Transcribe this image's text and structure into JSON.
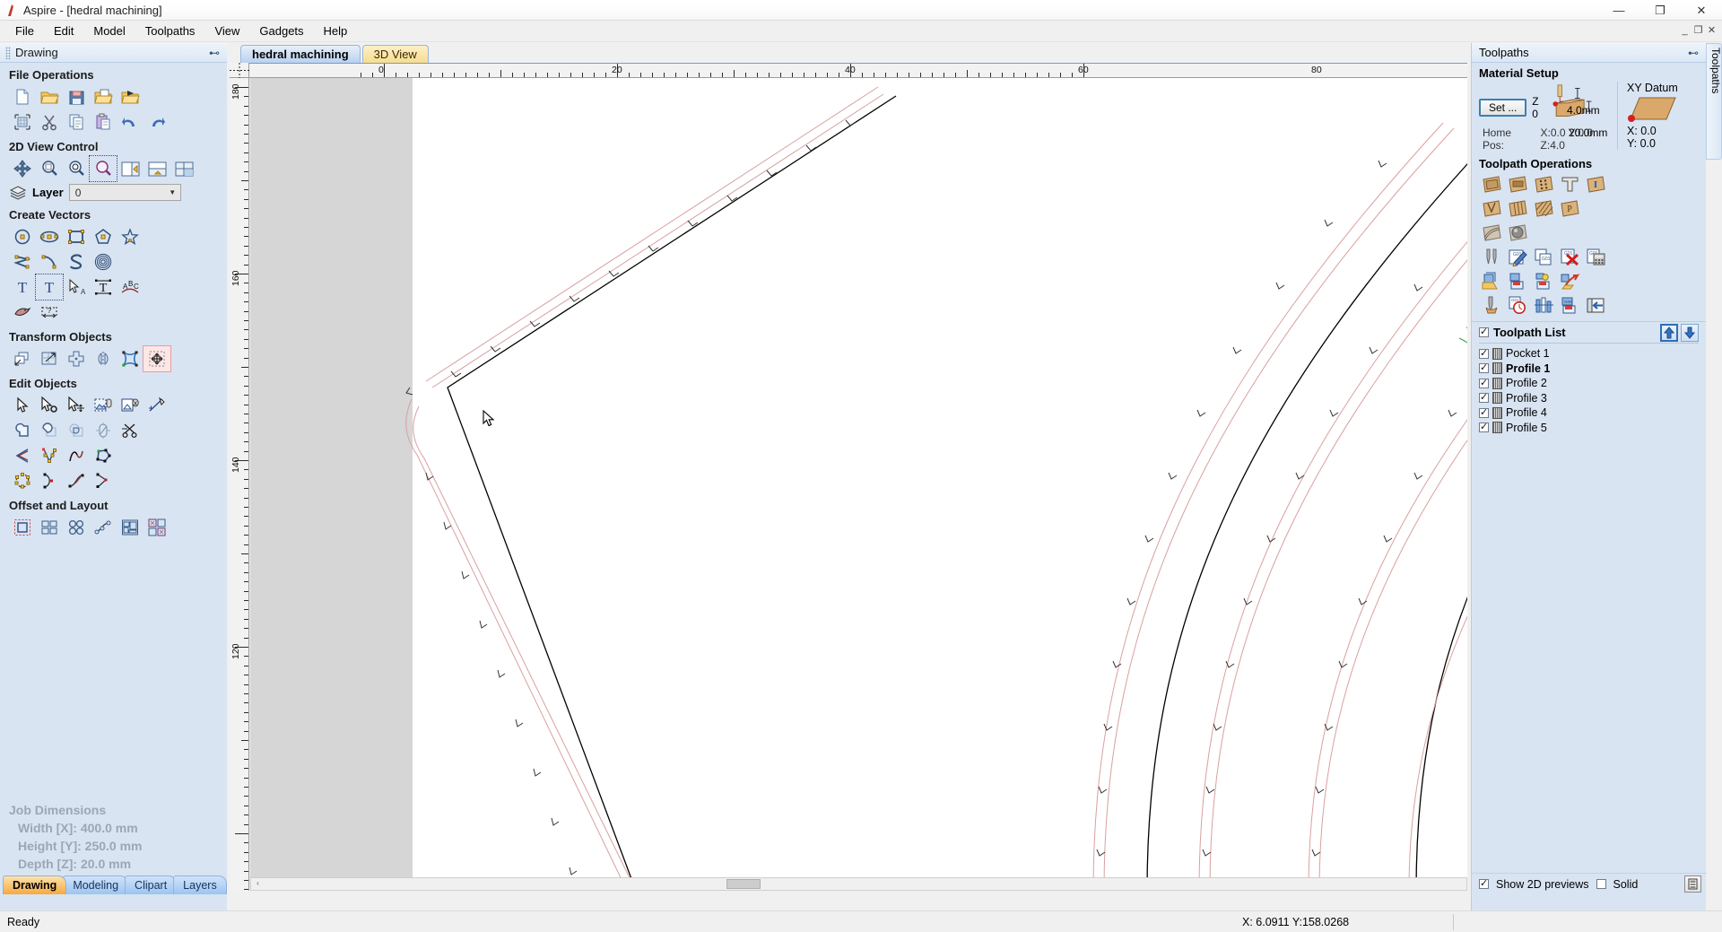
{
  "window": {
    "title": "Aspire - [hedral machining]",
    "app_icon": "aspire-logo-icon",
    "buttons": {
      "minimize": "—",
      "maximize": "❐",
      "close": "✕"
    },
    "mdi_buttons": {
      "minimize": "_",
      "restore": "❐",
      "close": "✕"
    }
  },
  "menubar": {
    "items": [
      {
        "label": "File"
      },
      {
        "label": "Edit"
      },
      {
        "label": "Model"
      },
      {
        "label": "Toolpaths"
      },
      {
        "label": "View"
      },
      {
        "label": "Gadgets"
      },
      {
        "label": "Help"
      }
    ]
  },
  "left_panel": {
    "caption": "Drawing",
    "pin_icon": "pin-icon",
    "sections": [
      {
        "title": "File Operations",
        "rows": [
          [
            "new-file-icon",
            "open-file-icon",
            "save-file-icon",
            "open-recent-icon",
            "import-vectors-icon"
          ],
          [
            "job-setup-icon",
            "cut-icon",
            "copy-icon",
            "paste-icon",
            "undo-icon",
            "redo-icon"
          ]
        ]
      },
      {
        "title": "2D View Control",
        "rows": [
          [
            "pan-view-icon",
            "zoom-window-icon",
            "zoom-selection-icon",
            "zoom-interactive-icon",
            "toggle-left-panel-icon",
            "toggle-split-view-icon",
            "toggle-layout-icon"
          ]
        ]
      },
      {
        "title": "Create Vectors",
        "rows": [
          [
            "circle-icon",
            "ellipse-icon",
            "rectangle-icon",
            "polygon-icon",
            "star-icon"
          ],
          [
            "polyline-icon",
            "arc-icon",
            "curve-icon",
            "spiral-icon"
          ],
          [
            "create-text-icon",
            "edit-text-icon",
            "text-select-icon",
            "text-on-curve-icon",
            "text-arc-icon"
          ],
          [
            "trace-bitmap-icon",
            "dimension-icon"
          ]
        ]
      },
      {
        "title": "Transform Objects",
        "rows": [
          [
            "move-object-icon",
            "scale-object-icon",
            "rotate-object-icon",
            "mirror-object-icon",
            "distort-object-icon",
            "align-objects-icon"
          ]
        ]
      },
      {
        "title": "Edit Objects",
        "rows": [
          [
            "select-tool-icon",
            "node-edit-icon",
            "move-nodes-icon",
            "group-vectors-icon",
            "ungroup-vectors-icon",
            "measure-icon"
          ],
          [
            "weld-vectors-icon",
            "subtract-vectors-icon",
            "intersect-vectors-icon",
            "fillet-icon",
            "trim-vectors-icon"
          ],
          [
            "join-open-vectors-icon",
            "node-tools-icon",
            "curve-fit-icon",
            "close-vector-icon"
          ],
          [
            "create-boundary-icon",
            "offset-corner-icon",
            "smooth-curve-icon",
            "split-vector-icon"
          ]
        ]
      },
      {
        "title": "Offset and Layout",
        "rows": [
          [
            "offset-vectors-icon",
            "array-copy-icon",
            "block-copy-icon",
            "copy-along-curve-icon",
            "nesting-icon",
            "plate-layout-icon"
          ]
        ]
      }
    ],
    "layer": {
      "label": "Layer",
      "icon": "layers-icon",
      "value": "0"
    },
    "job_dimensions": {
      "title": "Job Dimensions",
      "rows": [
        "Width  [X]: 400.0 mm",
        "Height [Y]: 250.0 mm",
        "Depth  [Z]: 20.0 mm"
      ]
    },
    "tabs": [
      {
        "label": "Drawing",
        "active": true
      },
      {
        "label": "Modeling",
        "active": false
      },
      {
        "label": "Clipart",
        "active": false
      },
      {
        "label": "Layers",
        "active": false
      }
    ]
  },
  "canvas": {
    "tabs": [
      {
        "label": "hedral machining",
        "active": true
      },
      {
        "label": "3D View",
        "active": false
      }
    ],
    "ruler_h": {
      "labels": [
        "0",
        "20",
        "40",
        "60",
        "80"
      ],
      "unit": "mm"
    },
    "ruler_v": {
      "labels": [
        "180",
        "160",
        "140",
        "120"
      ],
      "unit": "mm"
    },
    "scrollbar": {
      "left_arrow": "‹"
    }
  },
  "right_panel": {
    "caption": "Toolpaths",
    "pin_icon": "pin-icon",
    "side_tab_label": "Toolpaths",
    "material_setup": {
      "title": "Material Setup",
      "set_button": "Set ...",
      "z_label": "Z 0",
      "above_thickness": "4.0mm",
      "material_thickness": "20.0mm",
      "home_pos_label": "Home Pos:",
      "home_pos_value": "X:0.0 Y:0.0 Z:4.0"
    },
    "xy_datum": {
      "title": "XY Datum",
      "x": "X: 0.0",
      "y": "Y: 0.0"
    },
    "toolpath_operations": {
      "title": "Toolpath Operations",
      "rows": [
        [
          "profile-toolpath-icon",
          "pocket-toolpath-icon",
          "drilling-toolpath-icon",
          "vcarve-toolpath-icon",
          "inlay-toolpath-icon"
        ],
        [
          "fluting-toolpath-icon",
          "prism-carving-icon",
          "texture-toolpath-icon",
          "prism-toolpath-icon"
        ],
        [
          "rough-machining-icon",
          "finish-machining-icon"
        ],
        [
          "tool-database-icon",
          "edit-toolpath-icon",
          "duplicate-toolpath-icon",
          "delete-toolpath-icon",
          "toolpath-calculator-icon"
        ],
        [
          "toolpath-folder-icon",
          "save-toolpath-icon",
          "toolpath-template-icon",
          "merge-toolpaths-icon"
        ],
        [
          "toolpath-tool-icon",
          "estimate-time-icon",
          "toolpath-preview-icon",
          "save-all-toolpaths-icon",
          "close-panel-icon"
        ]
      ]
    },
    "toolpath_list": {
      "title": "Toolpath List",
      "select_all_checked": true,
      "move_up_icon": "arrow-up-icon",
      "move_down_icon": "arrow-down-icon",
      "items": [
        {
          "label": "Pocket 1",
          "checked": true,
          "bold": false
        },
        {
          "label": "Profile 1",
          "checked": true,
          "bold": true
        },
        {
          "label": "Profile 2",
          "checked": true,
          "bold": false
        },
        {
          "label": "Profile 3",
          "checked": true,
          "bold": false
        },
        {
          "label": "Profile 4",
          "checked": true,
          "bold": false
        },
        {
          "label": "Profile 5",
          "checked": true,
          "bold": false
        }
      ]
    },
    "footer": {
      "show_2d_previews": {
        "label": "Show 2D previews",
        "checked": true
      },
      "solid": {
        "label": "Solid",
        "checked": false
      },
      "solid_button_icon": "solid-view-icon"
    }
  },
  "statusbar": {
    "ready": "Ready",
    "coords": "X:  6.0911 Y:158.0268"
  },
  "colors": {
    "panel_bg": "#d9e4f2",
    "caption_bg": "#e4eefa",
    "accent_blue": "#3c7fb1",
    "tab_active_orange": "#f5a93f",
    "toolpath_red": "#e8a9a9",
    "vector_black": "#000000",
    "vector_green": "#1f8f3a"
  }
}
